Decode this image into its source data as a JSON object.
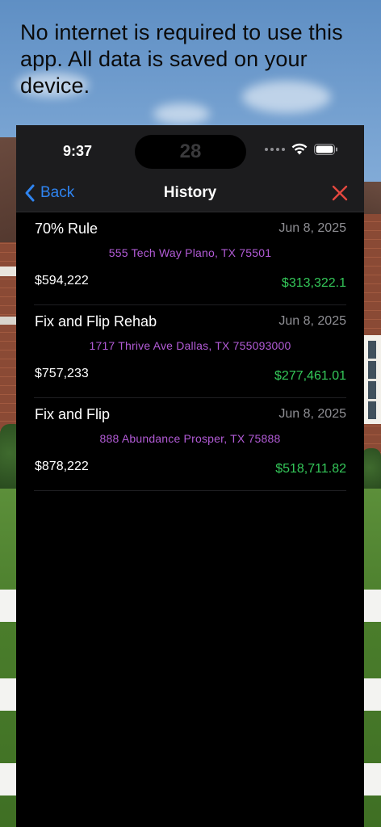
{
  "headline": "No internet is required to use this app. All data is saved on your device.",
  "status_bar": {
    "time": "9:37",
    "island_text": "28"
  },
  "nav": {
    "back_label": "Back",
    "title": "History"
  },
  "history": [
    {
      "title": "70% Rule",
      "date": "Jun 8, 2025",
      "address": "555 Tech Way Plano, TX 75501",
      "price": "$594,222",
      "profit": "$313,322.1"
    },
    {
      "title": "Fix and Flip Rehab",
      "date": "Jun 8, 2025",
      "address": "1717 Thrive Ave Dallas, TX 755093000",
      "price": "$757,233",
      "profit": "$277,461.01"
    },
    {
      "title": "Fix and Flip",
      "date": "Jun 8, 2025",
      "address": "888 Abundance Prosper, TX 75888",
      "price": "$878,222",
      "profit": "$518,711.82"
    }
  ],
  "colors": {
    "accent_blue": "#2f84f0",
    "close_red": "#e5483f",
    "address_purple": "#b25bd6",
    "profit_green": "#34c759"
  },
  "icons": {
    "back": "chevron-left-icon",
    "close": "close-icon",
    "wifi": "wifi-icon",
    "battery": "battery-icon"
  }
}
